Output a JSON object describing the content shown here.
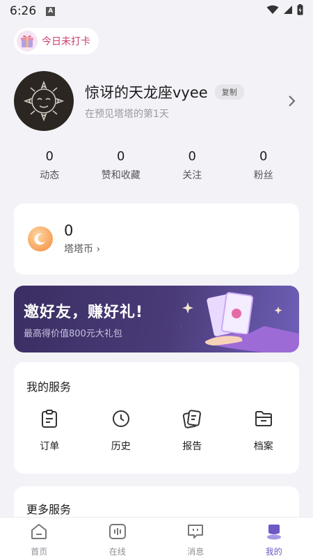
{
  "status_bar": {
    "time": "6:26",
    "notif_letter": "A"
  },
  "checkin": {
    "label": "今日未打卡"
  },
  "profile": {
    "name": "惊讶的天龙座vyee",
    "copy_label": "复制",
    "subtitle": "在预见塔塔的第1天"
  },
  "stats": [
    {
      "value": "0",
      "label": "动态"
    },
    {
      "value": "0",
      "label": "赞和收藏"
    },
    {
      "value": "0",
      "label": "关注"
    },
    {
      "value": "0",
      "label": "粉丝"
    }
  ],
  "coin": {
    "value": "0",
    "label": "塔塔币 ›"
  },
  "banner": {
    "title": "邀好友，赚好礼!",
    "subtitle": "最高得价值800元大礼包"
  },
  "services": {
    "title": "我的服务",
    "items": [
      {
        "label": "订单",
        "icon": "order-icon"
      },
      {
        "label": "历史",
        "icon": "clock-icon"
      },
      {
        "label": "报告",
        "icon": "report-icon"
      },
      {
        "label": "档案",
        "icon": "folder-icon"
      }
    ]
  },
  "more_services": {
    "title": "更多服务"
  },
  "tabbar": {
    "items": [
      {
        "label": "首页",
        "icon": "home-icon"
      },
      {
        "label": "在线",
        "icon": "online-icon"
      },
      {
        "label": "消息",
        "icon": "message-icon"
      },
      {
        "label": "我的",
        "icon": "profile-icon"
      }
    ],
    "active_index": 3
  },
  "colors": {
    "accent": "#6d58c4",
    "banner_bg": "#3b2e63",
    "checkin_text": "#c9406f",
    "coin": "#f38a3a"
  }
}
